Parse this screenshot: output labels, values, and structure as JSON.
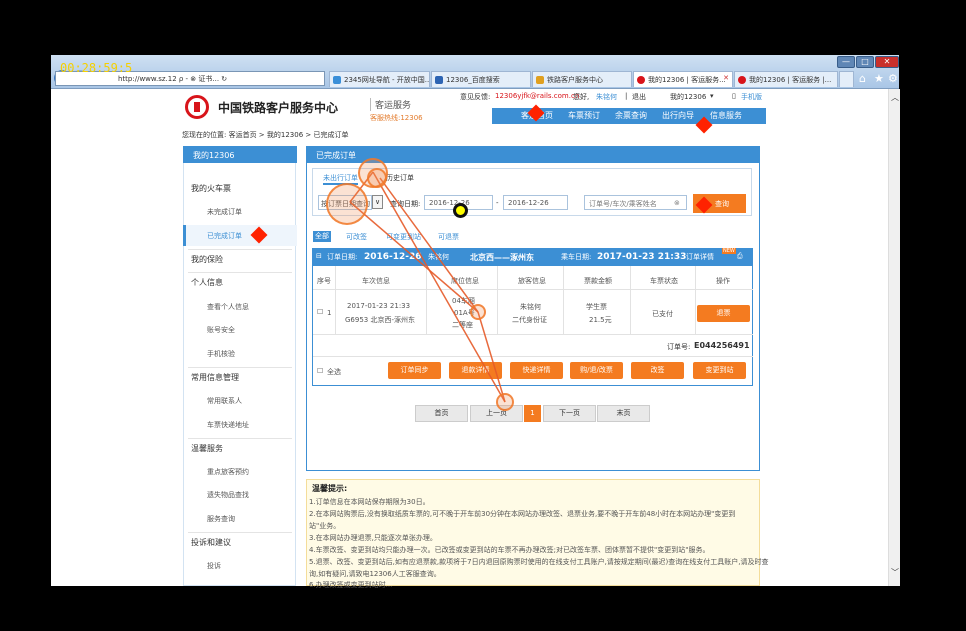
{
  "recording_timer": "00:28:59:5",
  "browser": {
    "address": "http://www.sz.12",
    "address_icons": "ρ - ⊗ 证书... ↻",
    "tabs": [
      {
        "label": "2345网址导航 - 开放中国..."
      },
      {
        "label": "12306_百度搜索"
      },
      {
        "label": "铁路客户服务中心"
      },
      {
        "label": "我的12306 | 客运服务...",
        "active": true
      },
      {
        "label": "我的12306 | 客运服务 |..."
      }
    ],
    "window_controls": [
      "—",
      "□",
      "✕"
    ],
    "toolbar_icons": [
      "home-icon",
      "star-icon",
      "gear-icon"
    ]
  },
  "site": {
    "title": "中国铁路客户服务中心",
    "subtitle": "客运服务",
    "hotline": "客服热线:12306",
    "feedback_label": "意见反馈:",
    "feedback_email": "12306yjfk@rails.com.cn",
    "greeting": "您好,",
    "user": "朱铭何",
    "logout": "退出",
    "my12306": "我的12306",
    "mobile": "手机版",
    "nav": [
      "客运首页",
      "车票预订",
      "余票查询",
      "出行向导",
      "信息服务"
    ]
  },
  "breadcrumb": "您现在的位置: 客运首页 > 我的12306 > 已完成订单",
  "sidebar": {
    "head": "我的12306",
    "sections": [
      {
        "title": "我的火车票",
        "items": [
          "未完成订单",
          "已完成订单"
        ]
      },
      {
        "title": "我的保险",
        "items": []
      },
      {
        "title": "个人信息",
        "items": [
          "查看个人信息",
          "账号安全",
          "手机核验"
        ]
      },
      {
        "title": "常用信息管理",
        "items": [
          "常用联系人",
          "车票快递地址"
        ]
      },
      {
        "title": "温馨服务",
        "items": [
          "重点旅客预约",
          "遗失物品查找",
          "服务查询"
        ]
      },
      {
        "title": "投诉和建议",
        "items": [
          "投诉"
        ]
      }
    ]
  },
  "content": {
    "head": "已完成订单",
    "query_tabs": [
      "未出行订单",
      "历史订单"
    ],
    "query_type_label": "按订票日期查询",
    "query_date_label": "查询日期:",
    "date_from": "2016-12-26",
    "date_sep": "-",
    "date_to": "2016-12-26",
    "search_placeholder": "订单号/车次/乘客姓名",
    "query_button": "查询",
    "filter_tabs": [
      "全部",
      "可改签",
      "可变更到站",
      "可退票"
    ],
    "order": {
      "order_date_label": "订单日期:",
      "order_date": "2016-12-26",
      "passenger_name": "朱铭何",
      "route": "北京西——涿州东",
      "depart_label": "乘车日期:",
      "depart": "2017-01-23 21:33",
      "detail_link": "订单详情",
      "new_badge": "NEW",
      "columns": [
        "序号",
        "车次信息",
        "席位信息",
        "旅客信息",
        "票款金额",
        "车票状态",
        "操作"
      ],
      "rows": [
        {
          "no": "1",
          "train_time": "2017-01-23 21:33",
          "train": "G6953 北京西-涿州东",
          "seat1": "04车厢",
          "seat2": "01A号",
          "seat3": "二等座",
          "passenger": "朱铭何",
          "id_type": "二代身份证",
          "ticket_type": "学生票",
          "price": "21.5元",
          "status": "已支付",
          "action": "退票"
        }
      ],
      "order_no_label": "订单号:",
      "order_no": "E044256491",
      "select_all": "全选",
      "buttons": [
        "订单同步",
        "退款详情",
        "快递详情",
        "购/退/改票",
        "改签",
        "变更到站"
      ]
    },
    "pagination": [
      "首页",
      "上一页",
      "1",
      "下一页",
      "末页"
    ]
  },
  "tips": {
    "title": "温馨提示:",
    "lines": [
      "1.订单信息在本网站保存期限为30日。",
      "2.在本网站购票后,没有换取纸质车票的,可不晚于开车前30分钟在本网站办理改签、退票业务,要不晚于开车前48小时在本网站办理\"变更到",
      "站\"业务。",
      "3.在本网站办理退票,只能逐次单张办理。",
      "4.车票改签、变更到站均只能办理一次。已改签或变更到站的车票不再办理改签;对已改签车票、团体票暂不提供\"变更到站\"服务。",
      "5.退票、改签、变更到站后,如有应退票款,款项将于7日内退回原购票时使用的在线支付工具账户,请按规定期间(最迟)查询在线支付工具账户,请及时查",
      "询,如有疑问,请致电12306人工客服查询。",
      "6.办理改签或变更到站时..."
    ]
  }
}
